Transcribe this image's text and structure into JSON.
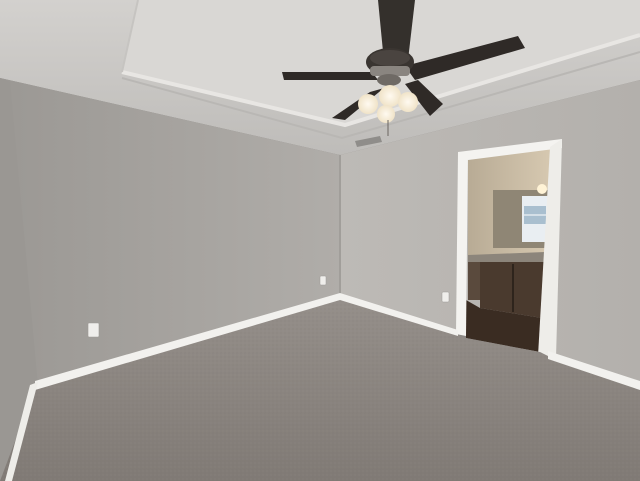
{
  "scene": {
    "colors": {
      "ceiling": "#cfcdca",
      "ceiling_tray": "#d8d6d3",
      "left_wall": "#a9a6a2",
      "back_wall": "#b4b1ad",
      "right_wall": "#bab7b3",
      "carpet": "#8d8782",
      "baseboard": "#f2f1ee",
      "door_trim": "#f4f3f0",
      "bathroom_wall": "#cdbfa8",
      "vanity_cabinet": "#4a3a2e",
      "bathroom_floor": "#3a2c22",
      "fan_blade": "#2f2a27",
      "fan_light": "#fff4dc"
    },
    "objects": [
      "ceiling-fan-icon",
      "light-kit-icon",
      "air-vent-icon",
      "doorway",
      "bathroom-mirror",
      "bathroom-vanity",
      "electrical-outlet-icon"
    ]
  }
}
